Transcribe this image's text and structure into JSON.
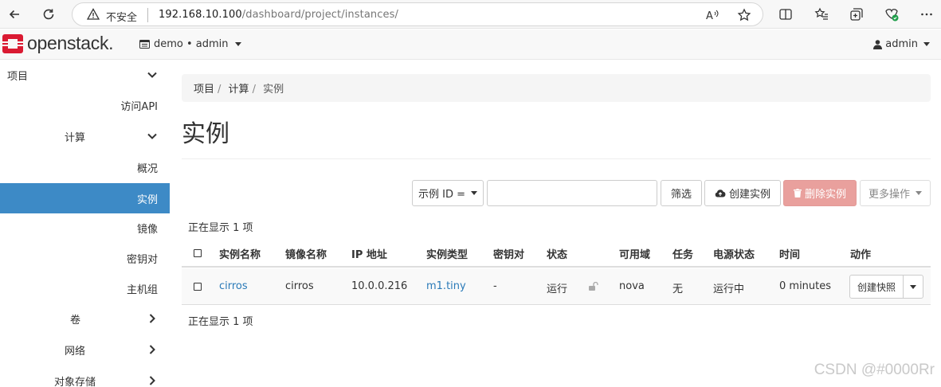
{
  "browser": {
    "security_label": "不安全",
    "url_host": "192.168.10.100",
    "url_path": "/dashboard/project/instances/"
  },
  "header": {
    "logo_text": "openstack.",
    "project_selector": "demo • admin",
    "user_menu": "admin"
  },
  "sidebar": {
    "items": [
      {
        "label": "项目"
      },
      {
        "label": "访问API"
      },
      {
        "label": "计算"
      },
      {
        "label": "概况"
      },
      {
        "label": "实例"
      },
      {
        "label": "镜像"
      },
      {
        "label": "密钥对"
      },
      {
        "label": "主机组"
      },
      {
        "label": "卷"
      },
      {
        "label": "网络"
      },
      {
        "label": "对象存储"
      }
    ]
  },
  "breadcrumb": [
    "项目",
    "计算",
    "实例"
  ],
  "page_title": "实例",
  "toolbar": {
    "filter_select": "示例 ID =",
    "filter_placeholder": "",
    "filter_button": "筛选",
    "create_button": "创建实例",
    "delete_button": "删除实例",
    "more_actions": "更多操作"
  },
  "count_text": "正在显示 1 项",
  "table": {
    "columns": [
      "实例名称",
      "镜像名称",
      "IP 地址",
      "实例类型",
      "密钥对",
      "状态",
      "可用域",
      "任务",
      "电源状态",
      "时间",
      "动作"
    ],
    "rows": [
      {
        "name": "cirros",
        "image": "cirros",
        "ip": "10.0.0.216",
        "flavor": "m1.tiny",
        "keypair": "-",
        "status": "运行",
        "zone": "nova",
        "task": "无",
        "power": "运行中",
        "age": "0 minutes",
        "action": "创建快照"
      }
    ]
  },
  "watermark": "CSDN @#0000Rr",
  "colors": {
    "active_nav": "#3d8ac6",
    "link": "#2a7ab8",
    "danger_button": "#e9a09d",
    "logo_red": "#da1a32"
  }
}
